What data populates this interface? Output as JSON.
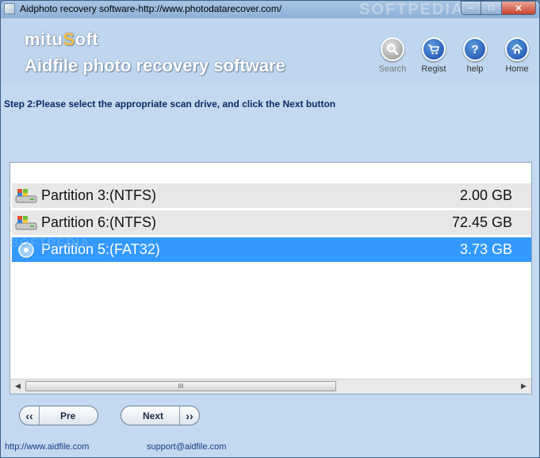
{
  "window": {
    "title": "Aidphoto recovery software-http://www.photodatarecover.com/",
    "watermark": "SOFTPEDIA",
    "controls": {
      "minimize": "–",
      "maximize": "□",
      "close": "✕"
    }
  },
  "header": {
    "logo_prefix": "mitu",
    "logo_s": "S",
    "logo_suffix": "oft",
    "app_name": "Aidfile photo recovery software",
    "buttons": [
      {
        "label": "Search",
        "icon": "magnifier-icon",
        "enabled": false
      },
      {
        "label": "Regist",
        "icon": "cart-icon",
        "enabled": true
      },
      {
        "label": "help",
        "icon": "question-icon",
        "enabled": true
      },
      {
        "label": "Home",
        "icon": "house-icon",
        "enabled": true
      }
    ]
  },
  "step_text": "Step 2:Please select the appropriate scan drive, and click the Next button",
  "partitions": [
    {
      "name": "Partition 3:(NTFS)",
      "size": "2.00 GB",
      "selected": false
    },
    {
      "name": "Partition 6:(NTFS)",
      "size": "72.45 GB",
      "selected": false
    },
    {
      "name": "Partition 5:(FAT32)",
      "size": "3.73 GB",
      "selected": true
    }
  ],
  "list_watermark": "SOFTPEDIA",
  "scrollbar": {
    "grip": "III"
  },
  "nav": {
    "pre_label": "Pre",
    "pre_arrow": "‹‹",
    "next_label": "Next",
    "next_arrow": "››"
  },
  "footer": {
    "website": "http://www.aidfile.com",
    "email": "support@aidfile.com"
  },
  "colors": {
    "selection": "#3399ff",
    "background": "#c4d9ef",
    "step_text": "#0d2a66"
  }
}
